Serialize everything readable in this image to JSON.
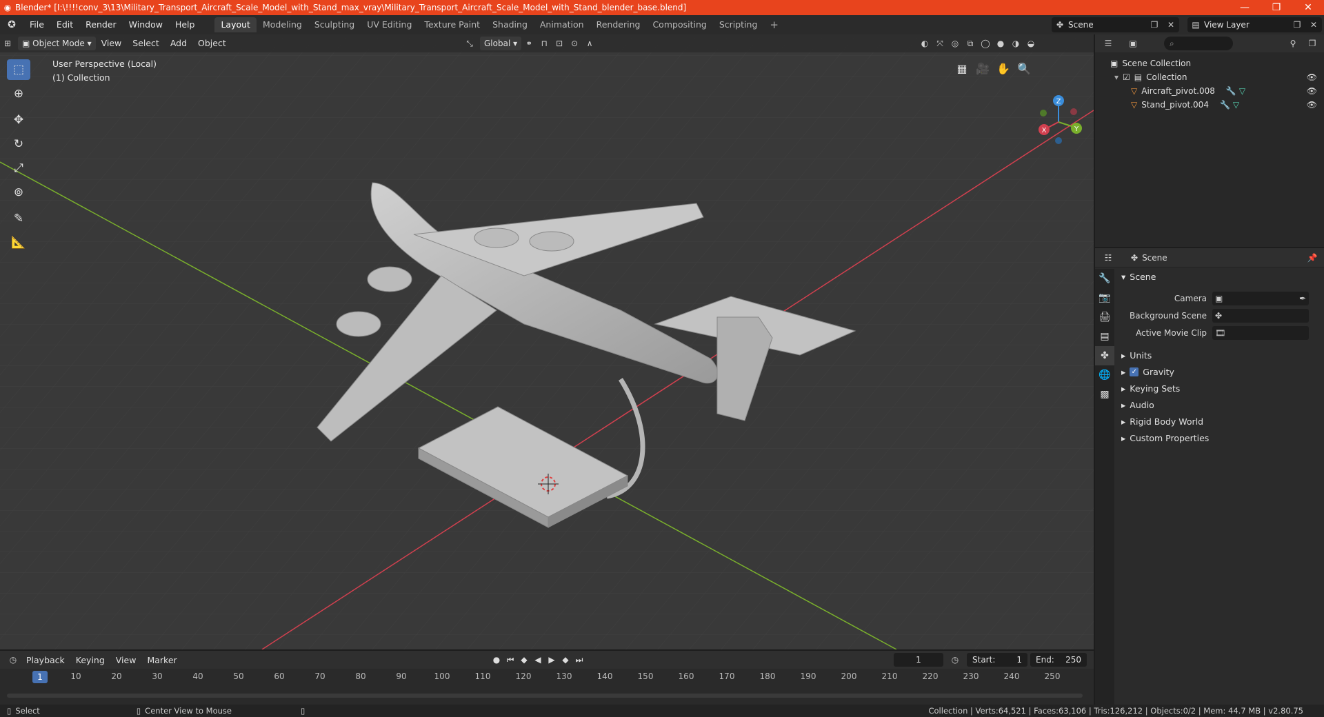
{
  "titlebar": {
    "title": "Blender* [I:\\!!!!conv_3\\13\\Military_Transport_Aircraft_Scale_Model_with_Stand_max_vray\\Military_Transport_Aircraft_Scale_Model_with_Stand_blender_base.blend]",
    "minimize": "—",
    "restore": "❐",
    "close": "✕"
  },
  "menu": [
    "File",
    "Edit",
    "Render",
    "Window",
    "Help"
  ],
  "workspaces": [
    "Layout",
    "Modeling",
    "Sculpting",
    "UV Editing",
    "Texture Paint",
    "Shading",
    "Animation",
    "Rendering",
    "Compositing",
    "Scripting"
  ],
  "workspace_add": "+",
  "scene_selector": "Scene",
  "view_layer_selector": "View Layer",
  "viewport": {
    "mode": "Object Mode",
    "menus": [
      "View",
      "Select",
      "Add",
      "Object"
    ],
    "transform_orientation": "Global",
    "perspective_label": "User Perspective (Local)",
    "collection_label": "(1) Collection"
  },
  "gizmo": {
    "z": "Z",
    "y": "Y",
    "x": "X"
  },
  "outliner": {
    "search_placeholder": "⌕",
    "scene_collection": "Scene Collection",
    "collection": "Collection",
    "objects": [
      "Aircraft_pivot.008",
      "Stand_pivot.004"
    ]
  },
  "properties": {
    "header": "Scene",
    "section": "Scene",
    "fields": [
      {
        "label": "Camera",
        "value": ""
      },
      {
        "label": "Background Scene",
        "value": ""
      },
      {
        "label": "Active Movie Clip",
        "value": ""
      }
    ],
    "subsections": [
      "Units",
      "Gravity",
      "Keying Sets",
      "Audio",
      "Rigid Body World",
      "Custom Properties"
    ],
    "gravity_checked": true
  },
  "timeline": {
    "menus": [
      "Playback",
      "Keying",
      "View",
      "Marker"
    ],
    "current_frame": "1",
    "start_label": "Start:",
    "start": "1",
    "end_label": "End:",
    "end": "250",
    "ticks": [
      "10",
      "20",
      "30",
      "40",
      "50",
      "60",
      "70",
      "80",
      "90",
      "100",
      "110",
      "120",
      "130",
      "140",
      "150",
      "160",
      "170",
      "180",
      "190",
      "200",
      "210",
      "220",
      "230",
      "240",
      "250"
    ]
  },
  "statusbar": {
    "select": "Select",
    "center_view": "Center View to Mouse",
    "stats": "Collection | Verts:64,521 | Faces:63,106 | Tris:126,212 | Objects:0/2 | Mem: 44.7 MB | v2.80.75"
  },
  "colors": {
    "title_bar": "#e8441d",
    "accent": "#4772b3",
    "x_axis": "#d2404f",
    "y_axis": "#7ab02c",
    "z_axis": "#3a8ddb"
  }
}
